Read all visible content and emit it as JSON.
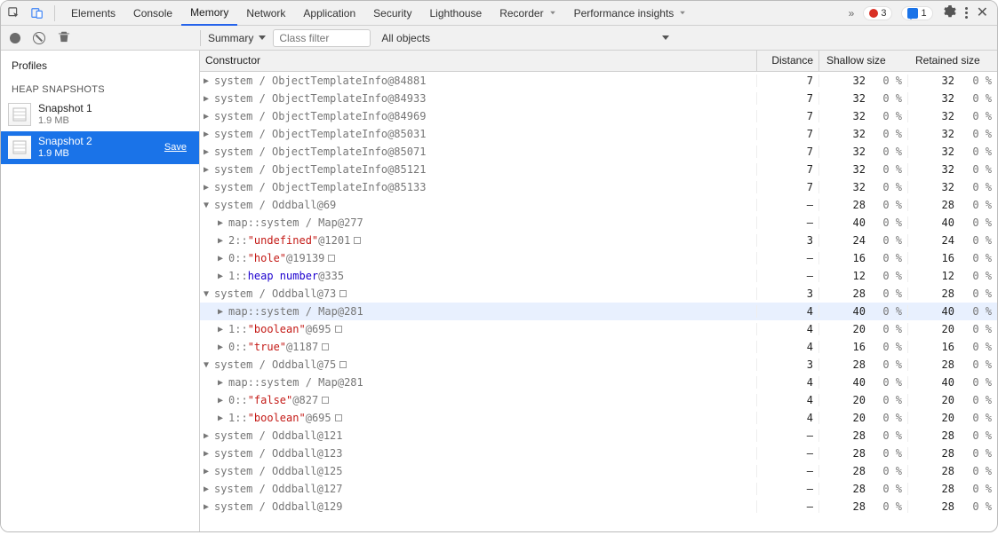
{
  "tabs": [
    "Elements",
    "Console",
    "Memory",
    "Network",
    "Application",
    "Security",
    "Lighthouse",
    "Recorder",
    "Performance insights"
  ],
  "active_tab": "Memory",
  "toolbar": {
    "errors": 3,
    "messages": 1,
    "more_icon": "»"
  },
  "subbar": {
    "summary_label": "Summary",
    "class_filter_placeholder": "Class filter",
    "objects_label": "All objects"
  },
  "sidebar": {
    "profiles_label": "Profiles",
    "category_label": "HEAP SNAPSHOTS",
    "snapshots": [
      {
        "name": "Snapshot 1",
        "size": "1.9 MB",
        "selected": false,
        "save": false
      },
      {
        "name": "Snapshot 2",
        "size": "1.9 MB",
        "selected": true,
        "save": true
      }
    ],
    "save_label": "Save"
  },
  "columns": {
    "constructor": "Constructor",
    "distance": "Distance",
    "shallow": "Shallow size",
    "retained": "Retained size"
  },
  "rows": [
    {
      "indent": 0,
      "arr": "▶",
      "tokens": [
        [
          "sys",
          "system / ObjectTemplateInfo"
        ],
        [
          "id",
          " @84881"
        ]
      ],
      "d": "7",
      "sn": "32",
      "sp": "0 %",
      "rn": "32",
      "rp": "0 %"
    },
    {
      "indent": 0,
      "arr": "▶",
      "tokens": [
        [
          "sys",
          "system / ObjectTemplateInfo"
        ],
        [
          "id",
          " @84933"
        ]
      ],
      "d": "7",
      "sn": "32",
      "sp": "0 %",
      "rn": "32",
      "rp": "0 %"
    },
    {
      "indent": 0,
      "arr": "▶",
      "tokens": [
        [
          "sys",
          "system / ObjectTemplateInfo"
        ],
        [
          "id",
          " @84969"
        ]
      ],
      "d": "7",
      "sn": "32",
      "sp": "0 %",
      "rn": "32",
      "rp": "0 %"
    },
    {
      "indent": 0,
      "arr": "▶",
      "tokens": [
        [
          "sys",
          "system / ObjectTemplateInfo"
        ],
        [
          "id",
          " @85031"
        ]
      ],
      "d": "7",
      "sn": "32",
      "sp": "0 %",
      "rn": "32",
      "rp": "0 %"
    },
    {
      "indent": 0,
      "arr": "▶",
      "tokens": [
        [
          "sys",
          "system / ObjectTemplateInfo"
        ],
        [
          "id",
          " @85071"
        ]
      ],
      "d": "7",
      "sn": "32",
      "sp": "0 %",
      "rn": "32",
      "rp": "0 %"
    },
    {
      "indent": 0,
      "arr": "▶",
      "tokens": [
        [
          "sys",
          "system / ObjectTemplateInfo"
        ],
        [
          "id",
          " @85121"
        ]
      ],
      "d": "7",
      "sn": "32",
      "sp": "0 %",
      "rn": "32",
      "rp": "0 %"
    },
    {
      "indent": 0,
      "arr": "▶",
      "tokens": [
        [
          "sys",
          "system / ObjectTemplateInfo"
        ],
        [
          "id",
          " @85133"
        ]
      ],
      "d": "7",
      "sn": "32",
      "sp": "0 %",
      "rn": "32",
      "rp": "0 %"
    },
    {
      "indent": 0,
      "arr": "▼",
      "tokens": [
        [
          "sys",
          "system / Oddball"
        ],
        [
          "id",
          " @69"
        ]
      ],
      "d": "–",
      "sn": "28",
      "sp": "0 %",
      "rn": "28",
      "rp": "0 %"
    },
    {
      "indent": 1,
      "arr": "▶",
      "tokens": [
        [
          "link",
          "map"
        ],
        [
          "sys",
          " :: "
        ],
        [
          "sys",
          "system / Map"
        ],
        [
          "id",
          " @277"
        ]
      ],
      "d": "–",
      "sn": "40",
      "sp": "0 %",
      "rn": "40",
      "rp": "0 %"
    },
    {
      "indent": 1,
      "arr": "▶",
      "tokens": [
        [
          "link",
          "2"
        ],
        [
          "sys",
          " :: "
        ],
        [
          "str",
          "\"undefined\""
        ],
        [
          "id",
          " @1201"
        ]
      ],
      "box": true,
      "d": "3",
      "sn": "24",
      "sp": "0 %",
      "rn": "24",
      "rp": "0 %"
    },
    {
      "indent": 1,
      "arr": "▶",
      "tokens": [
        [
          "link",
          "0"
        ],
        [
          "sys",
          " :: "
        ],
        [
          "str",
          "\"hole\""
        ],
        [
          "id",
          " @19139"
        ]
      ],
      "box": true,
      "d": "–",
      "sn": "16",
      "sp": "0 %",
      "rn": "16",
      "rp": "0 %"
    },
    {
      "indent": 1,
      "arr": "▶",
      "tokens": [
        [
          "link",
          "1"
        ],
        [
          "sys",
          " :: "
        ],
        [
          "kw",
          "heap number"
        ],
        [
          "id",
          " @335"
        ]
      ],
      "d": "–",
      "sn": "12",
      "sp": "0 %",
      "rn": "12",
      "rp": "0 %"
    },
    {
      "indent": 0,
      "arr": "▼",
      "tokens": [
        [
          "sys",
          "system / Oddball"
        ],
        [
          "id",
          " @73"
        ]
      ],
      "box": true,
      "d": "3",
      "sn": "28",
      "sp": "0 %",
      "rn": "28",
      "rp": "0 %"
    },
    {
      "indent": 1,
      "arr": "▶",
      "hilite": true,
      "tokens": [
        [
          "link",
          "map"
        ],
        [
          "sys",
          " :: "
        ],
        [
          "sys",
          "system / Map"
        ],
        [
          "id",
          " @281"
        ]
      ],
      "d": "4",
      "sn": "40",
      "sp": "0 %",
      "rn": "40",
      "rp": "0 %"
    },
    {
      "indent": 1,
      "arr": "▶",
      "tokens": [
        [
          "link",
          "1"
        ],
        [
          "sys",
          " :: "
        ],
        [
          "str",
          "\"boolean\""
        ],
        [
          "id",
          " @695"
        ]
      ],
      "box": true,
      "d": "4",
      "sn": "20",
      "sp": "0 %",
      "rn": "20",
      "rp": "0 %"
    },
    {
      "indent": 1,
      "arr": "▶",
      "tokens": [
        [
          "link",
          "0"
        ],
        [
          "sys",
          " :: "
        ],
        [
          "str",
          "\"true\""
        ],
        [
          "id",
          " @1187"
        ]
      ],
      "box": true,
      "d": "4",
      "sn": "16",
      "sp": "0 %",
      "rn": "16",
      "rp": "0 %"
    },
    {
      "indent": 0,
      "arr": "▼",
      "tokens": [
        [
          "sys",
          "system / Oddball"
        ],
        [
          "id",
          " @75"
        ]
      ],
      "box": true,
      "d": "3",
      "sn": "28",
      "sp": "0 %",
      "rn": "28",
      "rp": "0 %"
    },
    {
      "indent": 1,
      "arr": "▶",
      "tokens": [
        [
          "link",
          "map"
        ],
        [
          "sys",
          " :: "
        ],
        [
          "sys",
          "system / Map"
        ],
        [
          "id",
          " @281"
        ]
      ],
      "d": "4",
      "sn": "40",
      "sp": "0 %",
      "rn": "40",
      "rp": "0 %"
    },
    {
      "indent": 1,
      "arr": "▶",
      "tokens": [
        [
          "link",
          "0"
        ],
        [
          "sys",
          " :: "
        ],
        [
          "str",
          "\"false\""
        ],
        [
          "id",
          " @827"
        ]
      ],
      "box": true,
      "d": "4",
      "sn": "20",
      "sp": "0 %",
      "rn": "20",
      "rp": "0 %"
    },
    {
      "indent": 1,
      "arr": "▶",
      "tokens": [
        [
          "link",
          "1"
        ],
        [
          "sys",
          " :: "
        ],
        [
          "str",
          "\"boolean\""
        ],
        [
          "id",
          " @695"
        ]
      ],
      "box": true,
      "d": "4",
      "sn": "20",
      "sp": "0 %",
      "rn": "20",
      "rp": "0 %"
    },
    {
      "indent": 0,
      "arr": "▶",
      "tokens": [
        [
          "sys",
          "system / Oddball"
        ],
        [
          "id",
          " @121"
        ]
      ],
      "d": "–",
      "sn": "28",
      "sp": "0 %",
      "rn": "28",
      "rp": "0 %"
    },
    {
      "indent": 0,
      "arr": "▶",
      "tokens": [
        [
          "sys",
          "system / Oddball"
        ],
        [
          "id",
          " @123"
        ]
      ],
      "d": "–",
      "sn": "28",
      "sp": "0 %",
      "rn": "28",
      "rp": "0 %"
    },
    {
      "indent": 0,
      "arr": "▶",
      "tokens": [
        [
          "sys",
          "system / Oddball"
        ],
        [
          "id",
          " @125"
        ]
      ],
      "d": "–",
      "sn": "28",
      "sp": "0 %",
      "rn": "28",
      "rp": "0 %"
    },
    {
      "indent": 0,
      "arr": "▶",
      "tokens": [
        [
          "sys",
          "system / Oddball"
        ],
        [
          "id",
          " @127"
        ]
      ],
      "d": "–",
      "sn": "28",
      "sp": "0 %",
      "rn": "28",
      "rp": "0 %"
    },
    {
      "indent": 0,
      "arr": "▶",
      "tokens": [
        [
          "sys",
          "system / Oddball"
        ],
        [
          "id",
          " @129"
        ]
      ],
      "d": "–",
      "sn": "28",
      "sp": "0 %",
      "rn": "28",
      "rp": "0 %"
    }
  ]
}
